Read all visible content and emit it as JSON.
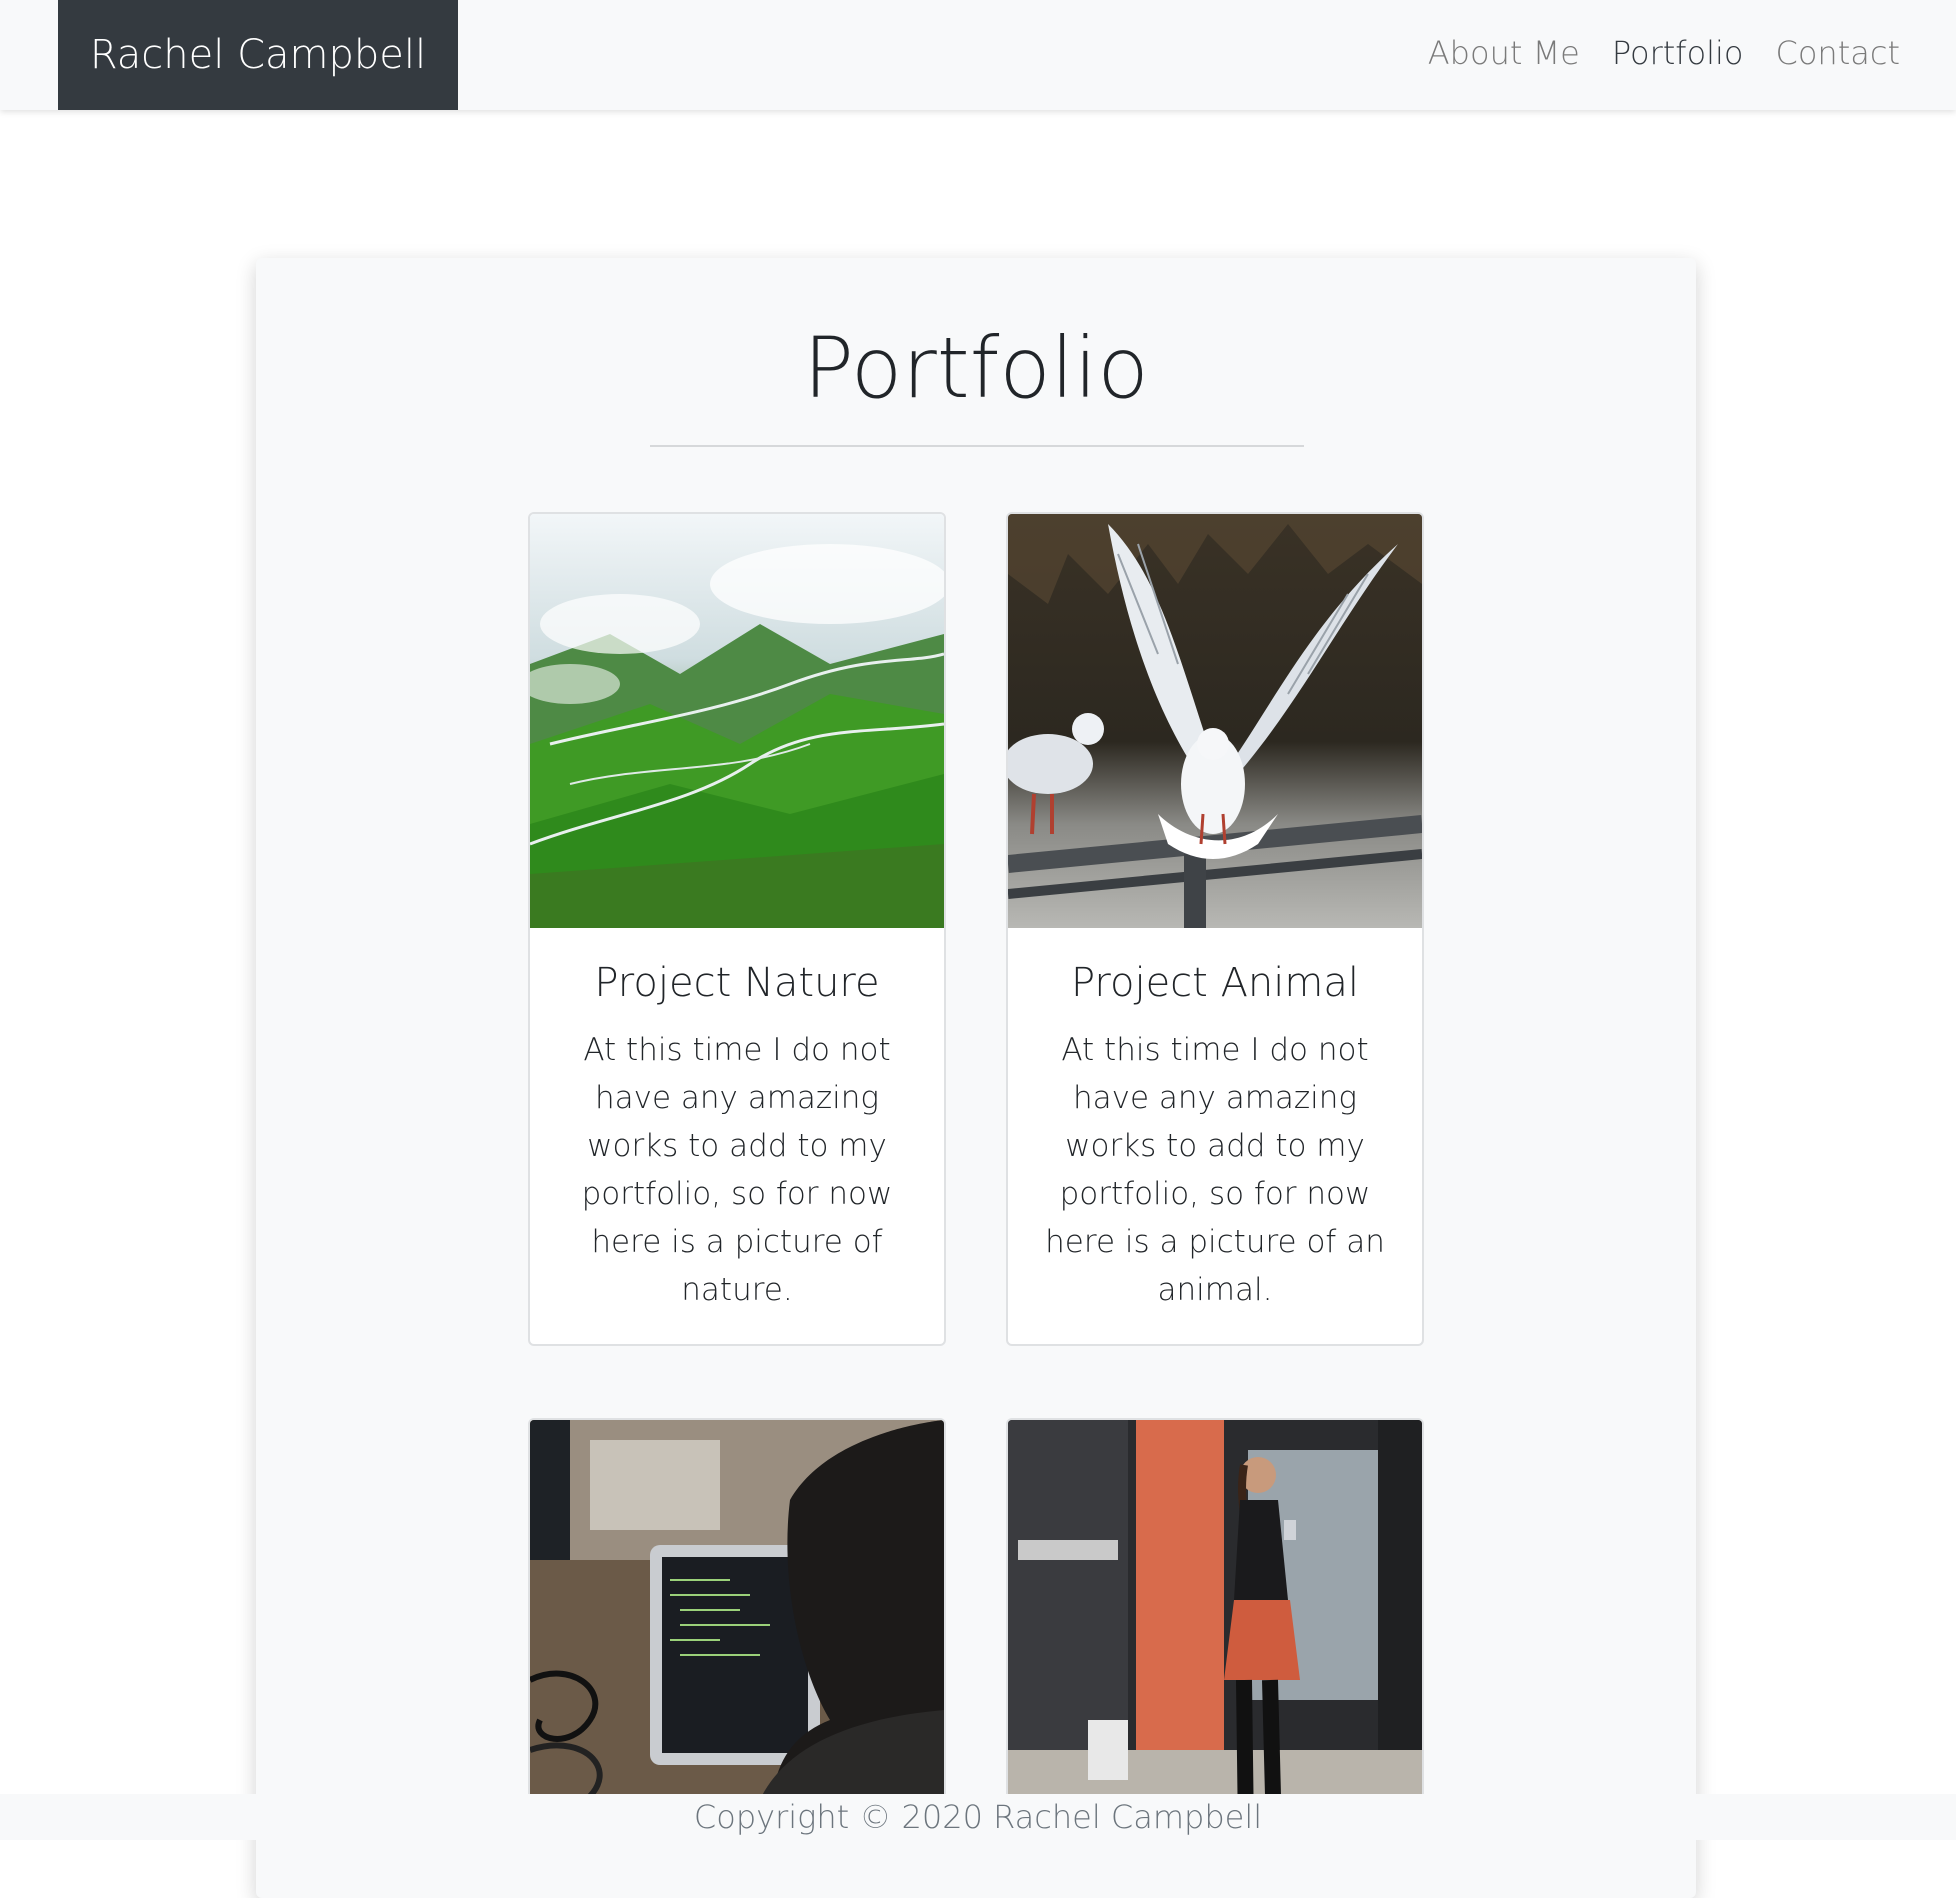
{
  "navbar": {
    "brand": "Rachel Campbell",
    "links": [
      {
        "label": "About Me",
        "active": false
      },
      {
        "label": "Portfolio",
        "active": true
      },
      {
        "label": "Contact",
        "active": false
      }
    ]
  },
  "main": {
    "title": "Portfolio",
    "cards": [
      {
        "title": "Project Nature",
        "text": "At this time I do not have any amazing works to add to my portfolio, so for now here is a picture of nature.",
        "image": "mountain-valley-photo"
      },
      {
        "title": "Project Animal",
        "text": "At this time I do not have any amazing works to add to my portfolio, so for now here is a picture of an animal.",
        "image": "seagulls-photo"
      },
      {
        "image": "person-at-laptop-photo"
      },
      {
        "image": "woman-with-phone-photo"
      }
    ]
  },
  "footer": {
    "copyright": "Copyright © 2020 Rachel Campbell"
  },
  "colors": {
    "navbar_bg": "#f8f9fa",
    "brand_bg": "#343a40",
    "panel_bg": "#f8f9fa",
    "card_border": "#dfe1e3",
    "muted_text": "#6c757d"
  }
}
